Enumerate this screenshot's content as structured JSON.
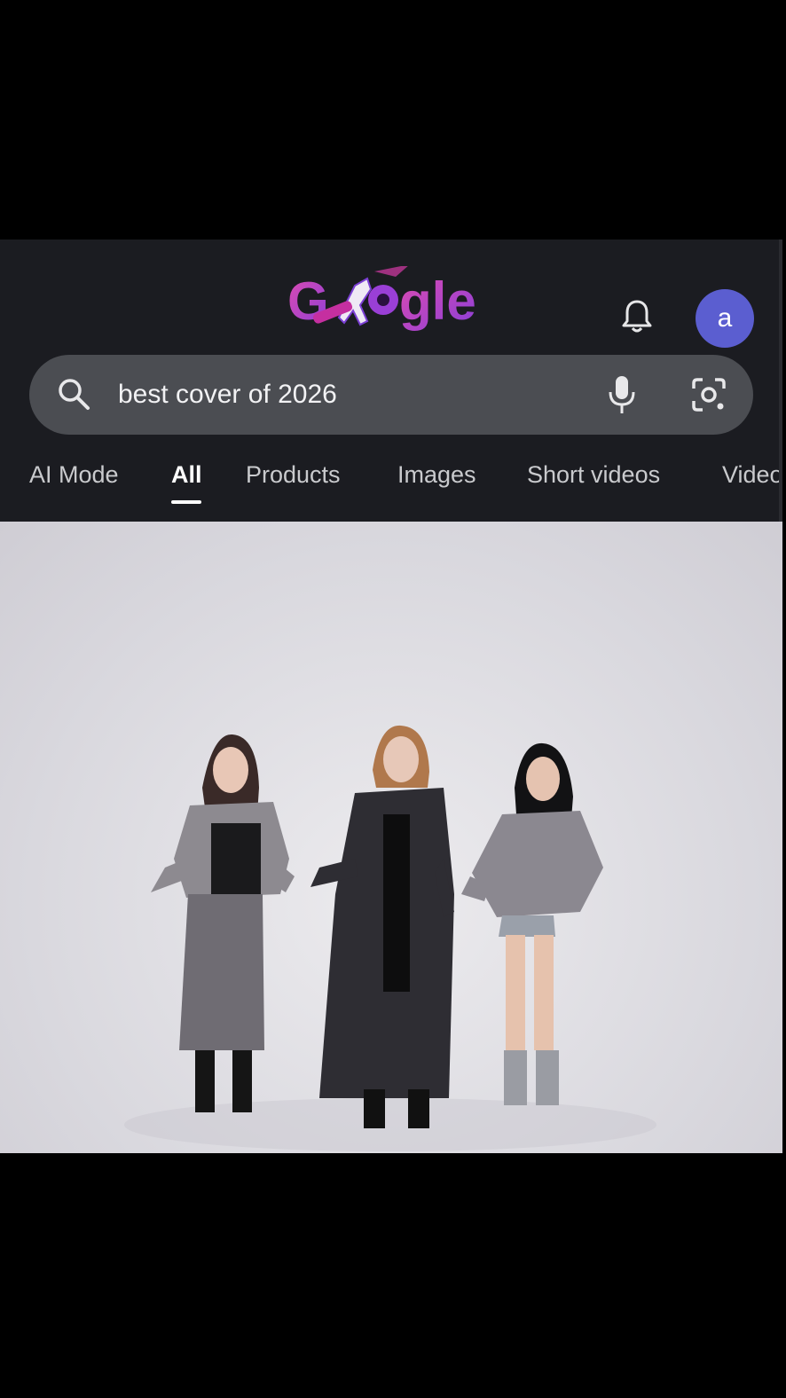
{
  "header": {
    "logo_text": "Google",
    "avatar_letter": "a"
  },
  "search": {
    "query": "best cover of 2026"
  },
  "tabs": [
    {
      "label": "AI Mode",
      "active": false
    },
    {
      "label": "All",
      "active": true
    },
    {
      "label": "Products",
      "active": false
    },
    {
      "label": "Images",
      "active": false
    },
    {
      "label": "Short videos",
      "active": false
    },
    {
      "label": "Videos",
      "active": false
    }
  ],
  "icons": {
    "search": "search-icon",
    "mic": "microphone-icon",
    "lens": "google-lens-icon",
    "bell": "notification-bell-icon"
  },
  "colors": {
    "header_bg": "#1b1c21",
    "search_bg": "#4b4d52",
    "avatar_bg": "#5b5ed0",
    "doodle_pink": "#d63aa8",
    "doodle_purple": "#7b3fd4"
  }
}
